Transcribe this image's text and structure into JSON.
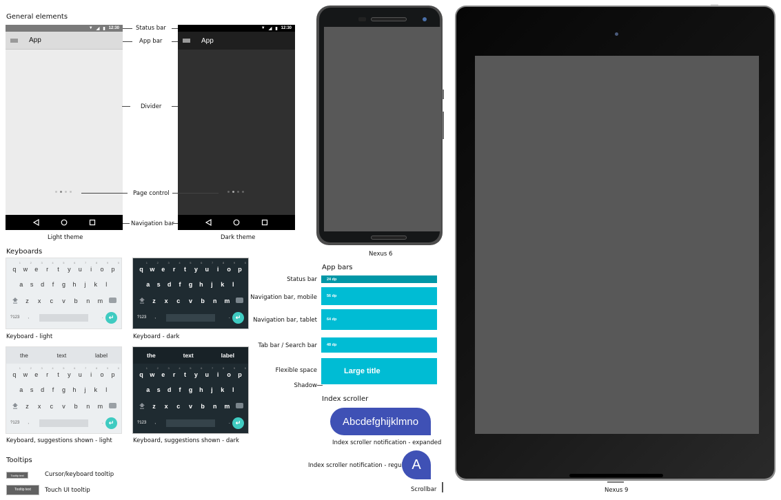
{
  "sections": {
    "general": "General elements",
    "keyboards": "Keyboards",
    "tooltips": "Tooltips",
    "app_bars": "App bars",
    "index_scroller": "Index scroller"
  },
  "phones": {
    "status_time": "12:30",
    "app_title": "App",
    "light_caption": "Light theme",
    "dark_caption": "Dark theme",
    "page_control_active_index": 1,
    "page_control_count": 4
  },
  "callouts": {
    "status_bar": "Status bar",
    "app_bar": "App bar",
    "divider": "Divider",
    "page_control": "Page control",
    "navigation_bar": "Navigation bar"
  },
  "keyboards": {
    "row1": [
      "q",
      "w",
      "e",
      "r",
      "t",
      "y",
      "u",
      "i",
      "o",
      "p"
    ],
    "row1_nums": [
      "1",
      "2",
      "3",
      "4",
      "5",
      "6",
      "7",
      "8",
      "9",
      "0"
    ],
    "row2": [
      "a",
      "s",
      "d",
      "f",
      "g",
      "h",
      "j",
      "k",
      "l"
    ],
    "row3": [
      "z",
      "x",
      "c",
      "v",
      "b",
      "n",
      "m"
    ],
    "symbols_key": "?123",
    "comma": ",",
    "period": ".",
    "suggestions": [
      "the",
      "text",
      "label"
    ],
    "captions": {
      "light": "Keyboard - light",
      "dark": "Keyboard - dark",
      "sugg_light": "Keyboard, suggestions shown - light",
      "sugg_dark": "Keyboard, suggestions shown - dark"
    }
  },
  "tooltips": {
    "cursor_tooltip_text": "Tooltip text",
    "cursor_label": "Cursor/keyboard tooltip",
    "touch_tooltip_text": "Tooltip text",
    "touch_label": "Touch UI tooltip"
  },
  "app_bars": [
    {
      "label": "Status bar",
      "size": "24 dp"
    },
    {
      "label": "Navigation bar, mobile",
      "size": "56 dp"
    },
    {
      "label": "Navigation bar, tablet",
      "size": "64 dp"
    },
    {
      "label": "Tab bar / Search bar",
      "size": "48 dp"
    },
    {
      "label": "Flexible space",
      "title": "Large title"
    }
  ],
  "shadow_label": "Shadow",
  "index_scroller": {
    "expanded_text": "Abcdefghijklmno",
    "expanded_label": "Index scroller notification - expanded",
    "regular_text": "A",
    "regular_label": "Index scroller notification - regular",
    "scrollbar_label": "Scrollbar"
  },
  "devices": {
    "nexus6": "Nexus 6",
    "nexus9": "Nexus 9"
  },
  "colors": {
    "accent_teal": "#00bcd4",
    "status_teal": "#0097a7",
    "index_indigo": "#3f51b5",
    "enter_key": "#3fcbc1"
  }
}
